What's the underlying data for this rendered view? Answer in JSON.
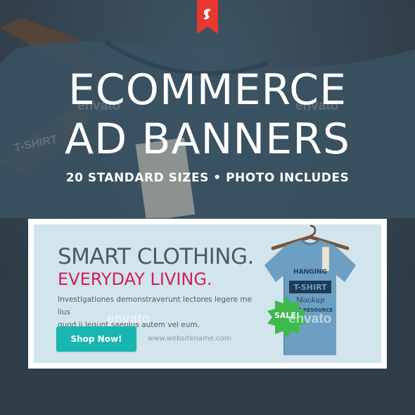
{
  "cover": {
    "title_line1": "ECOMMERCE",
    "title_line2": "AD BANNERS",
    "subtitle": "20 STANDARD SIZES • PHOTO INCLUDES",
    "watermark": "envato"
  },
  "background": {
    "tag_text": "T-SHIRT",
    "colors": {
      "base": "#34434f",
      "shirt": "#3a5261",
      "bookmark": "#e8382f"
    }
  },
  "banner": {
    "headline": "SMART CLOTHING.",
    "subhead": "EVERYDAY LIVING.",
    "body_line1": "Investigationes demonstraverunt lectores legere me lius",
    "body_line2": "quod ii legunt saepius autem vel eum.",
    "button_label": "Shop Now!",
    "url": "www.websitename.com",
    "sale_label": "SALE!",
    "shirt_print": {
      "line1": "HANGING",
      "line2": "T-SHIRT",
      "line3": "Mockup",
      "line4": "FREE RESOURCE"
    },
    "watermark": "envato",
    "colors": {
      "panel": "#d2e5ec",
      "headline": "#4b5a64",
      "accent": "#d21e5a",
      "button": "#17b7b0",
      "sale": "#3fb94e",
      "shirt": "#6c9fc1"
    }
  },
  "icons": [
    "bookmark-logo-icon",
    "envato-leaf-icon",
    "hanger-icon",
    "sale-starburst-icon"
  ]
}
